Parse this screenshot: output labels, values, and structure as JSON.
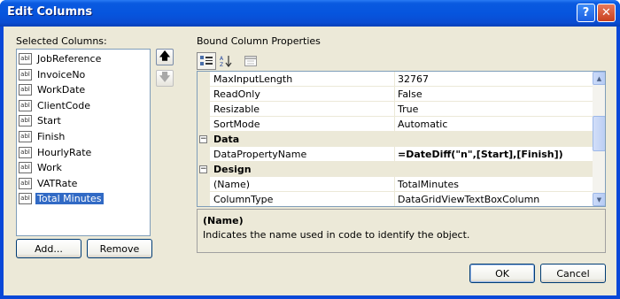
{
  "window": {
    "title": "Edit Columns",
    "help_glyph": "?",
    "close_glyph": "✕"
  },
  "left": {
    "label": "Selected Columns:",
    "badge": "abl",
    "columns": [
      "JobReference",
      "InvoiceNo",
      "WorkDate",
      "ClientCode",
      "Start",
      "Finish",
      "HourlyRate",
      "Work",
      "VATRate",
      "Total Minutes"
    ],
    "selected_index": 9,
    "add_label": "Add...",
    "remove_label": "Remove",
    "up_glyph": "🡅",
    "down_glyph": "🡇"
  },
  "right": {
    "label": "Bound Column Properties",
    "toolbar": {
      "categorized_icon": "categorized-icon",
      "alphabetical_icon": "alphabetical-icon",
      "property_pages_icon": "property-pages-icon"
    },
    "rows": [
      {
        "kind": "prop",
        "name": "MaxInputLength",
        "value": "32767"
      },
      {
        "kind": "prop",
        "name": "ReadOnly",
        "value": "False"
      },
      {
        "kind": "prop",
        "name": "Resizable",
        "value": "True"
      },
      {
        "kind": "prop",
        "name": "SortMode",
        "value": "Automatic"
      },
      {
        "kind": "cat",
        "name": "Data",
        "glyph": "−"
      },
      {
        "kind": "prop",
        "name": "DataPropertyName",
        "value": "=DateDiff(\"n\",[Start],[Finish])",
        "bold": true
      },
      {
        "kind": "cat",
        "name": "Design",
        "glyph": "−"
      },
      {
        "kind": "prop",
        "name": "(Name)",
        "value": "TotalMinutes"
      },
      {
        "kind": "prop",
        "name": "ColumnType",
        "value": "DataGridViewTextBoxColumn"
      }
    ],
    "help": {
      "title": "(Name)",
      "description": "Indicates the name used in code to identify the object."
    }
  },
  "buttons": {
    "ok": "OK",
    "cancel": "Cancel"
  },
  "colors": {
    "title_bar": "#0a5ae0",
    "dialog_bg": "#ece9d8",
    "selection": "#316ac5",
    "border": "#7f9db9"
  }
}
